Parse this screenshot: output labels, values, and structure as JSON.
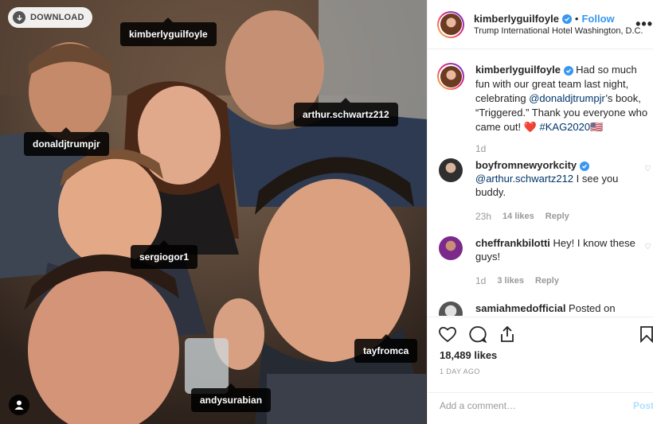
{
  "photo": {
    "download_label": "DOWNLOAD",
    "tags": [
      "kimberlyguilfoyle",
      "donaldjtrumpjr",
      "arthur.schwartz212",
      "sergiogor1",
      "tayfromca",
      "andysurabian"
    ]
  },
  "post": {
    "username": "kimberlyguilfoyle",
    "follow_label": "Follow",
    "separator": "•",
    "location": "Trump International Hotel Washington, D.C.",
    "more": "•••"
  },
  "caption": {
    "username": "kimberlyguilfoyle",
    "text_1": " Had so much fun with our great team last night, celebrating ",
    "mention": "@donaldjtrumpjr",
    "text_2": "’s book, “Triggered.” Thank you everyone who came out! ❤️ ",
    "hashtag": "#KAG2020",
    "flag": "🇺🇸",
    "time": "1d"
  },
  "comments": [
    {
      "username": "boyfromnewyorkcity",
      "mention": "@arthur.schwartz212",
      "text": " I see you buddy.",
      "time": "23h",
      "likes": "14 likes",
      "reply": "Reply"
    },
    {
      "username": "cheffrankbilotti",
      "mention": "",
      "text": " Hey! I know these guys!",
      "time": "1d",
      "likes": "3 likes",
      "reply": "Reply"
    },
    {
      "username": "samiahmedofficial",
      "mention": "",
      "text": " Posted on",
      "time": "",
      "likes": "",
      "reply": ""
    }
  ],
  "actions": {
    "likes": "18,489 likes",
    "date": "1 DAY AGO"
  },
  "add_comment": {
    "placeholder": "Add a comment…",
    "post_label": "Post"
  },
  "colors": {
    "accent": "#3897f0",
    "muted": "#999999",
    "tag_bg": "#000000"
  }
}
